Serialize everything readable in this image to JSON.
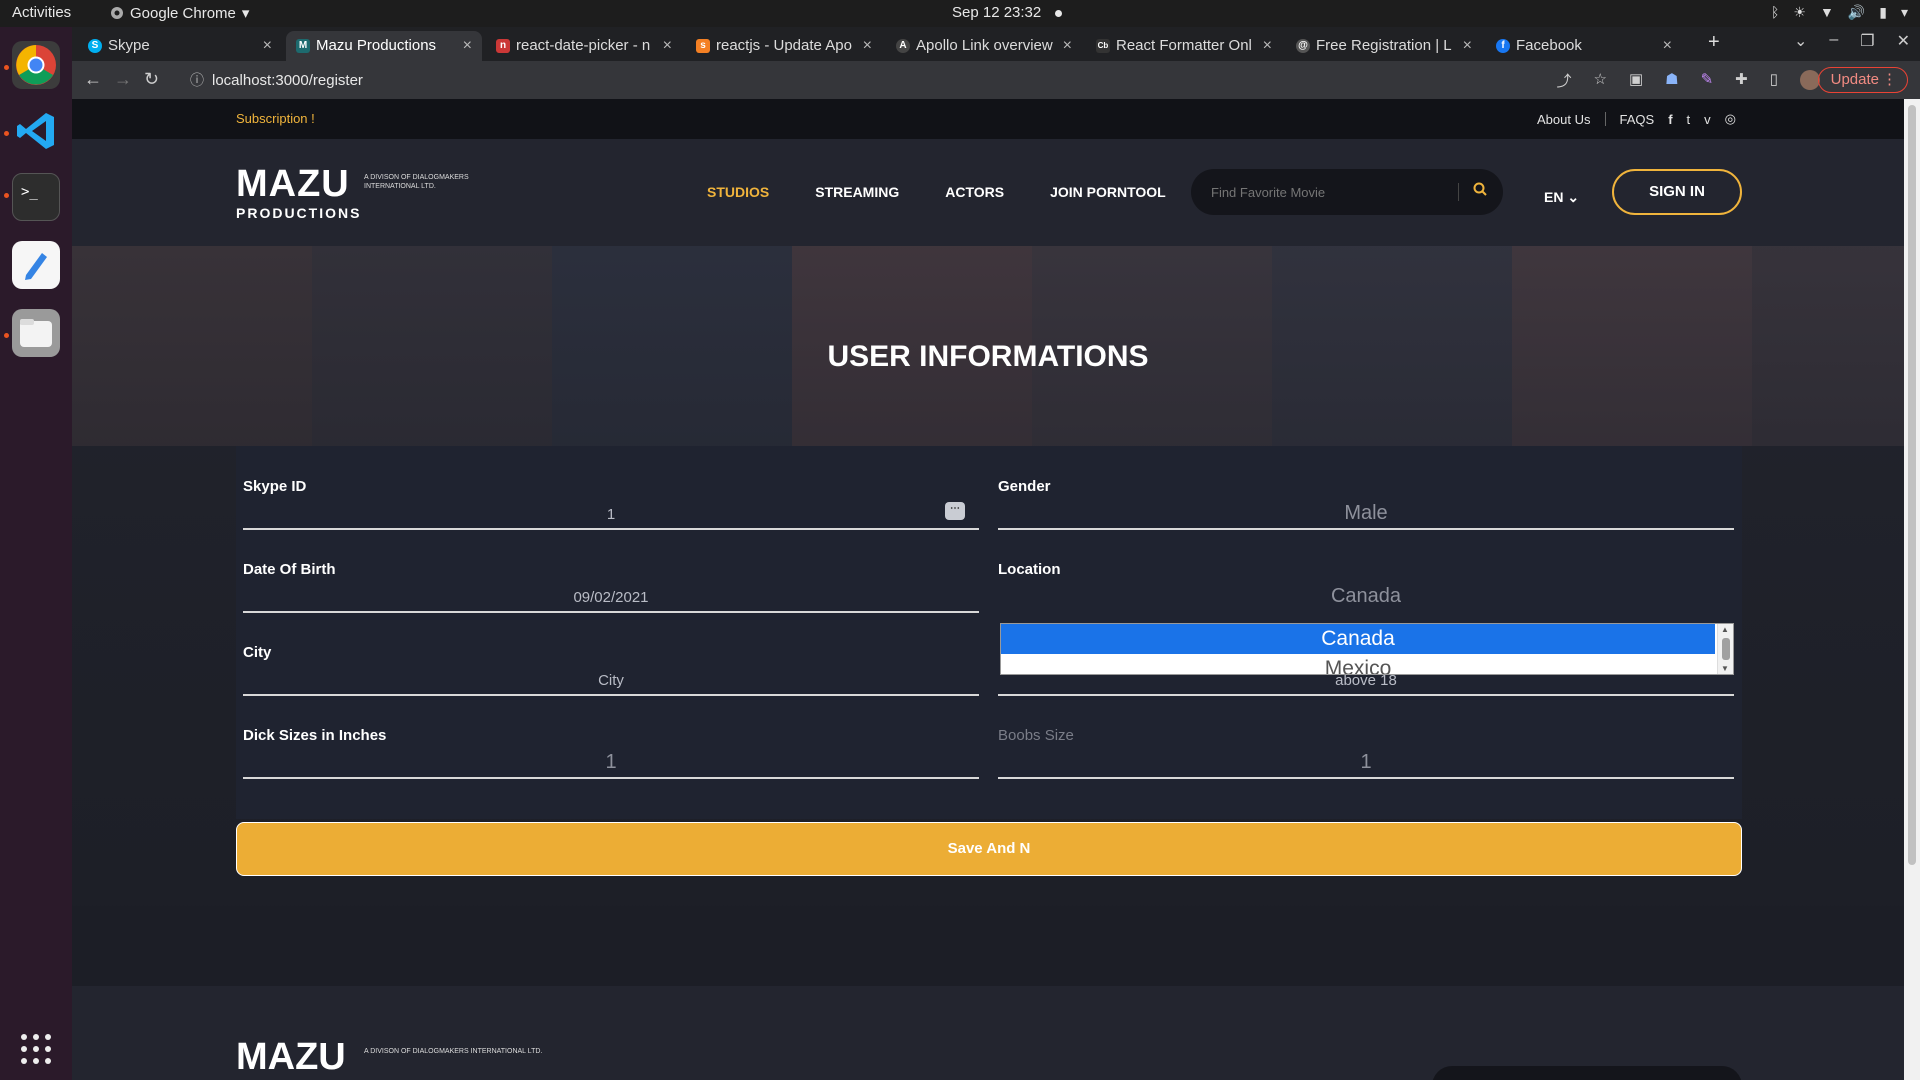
{
  "os": {
    "activities": "Activities",
    "app_name": "Google Chrome",
    "clock": "Sep 12  23:32"
  },
  "browser": {
    "tabs": [
      {
        "label": "Skype",
        "favicon_color": "#00aff0",
        "favicon": "S"
      },
      {
        "label": "Mazu Productions",
        "favicon_color": "#1d6a6e",
        "favicon": "M"
      },
      {
        "label": "react-date-picker - n",
        "favicon_color": "#cb3837",
        "favicon": "n"
      },
      {
        "label": "reactjs - Update Apo",
        "favicon_color": "#f48024",
        "favicon": "s"
      },
      {
        "label": "Apollo Link overview",
        "favicon_color": "#444",
        "favicon": "A"
      },
      {
        "label": "React Formatter Onl",
        "favicon_color": "#333",
        "favicon": "Cb"
      },
      {
        "label": "Free Registration | L",
        "favicon_color": "#555",
        "favicon": "@"
      },
      {
        "label": "Facebook",
        "favicon_color": "#1877f2",
        "favicon": "f"
      }
    ],
    "new_tab": "+",
    "url": "localhost:3000/register",
    "update_label": "Update"
  },
  "site": {
    "subscription": "Subscription !",
    "top_links": [
      "About Us",
      "FAQS"
    ],
    "social": [
      "f",
      "t",
      "v",
      "◎"
    ],
    "logo_text": "MAZU",
    "logo_sub": "A DIVISON OF DIALOGMAKERS INTERNATIONAL LTD.",
    "logo_prod": "PRODUCTIONS",
    "menu": [
      "STUDIOS",
      "STREAMING",
      "ACTORS",
      "JOIN PORNTOOL"
    ],
    "search_placeholder": "Find Favorite Movie",
    "lang": "EN",
    "sign_in": "SIGN IN"
  },
  "form": {
    "title": "USER INFORMATIONS",
    "skype_label": "Skype ID",
    "skype_value": "1",
    "gender_label": "Gender",
    "gender_value": "Male",
    "dob_label": "Date Of Birth",
    "dob_value": "09/02/2021",
    "location_label": "Location",
    "location_value": "Canada",
    "location_options": [
      "Canada",
      "Mexico"
    ],
    "city_label": "City",
    "city_placeholder": "City",
    "age_value": "above 18",
    "dick_label": "Dick Sizes in Inches",
    "dick_value": "1",
    "boobs_label": "Boobs Size",
    "boobs_value": "1",
    "save_label": "Save And N"
  }
}
